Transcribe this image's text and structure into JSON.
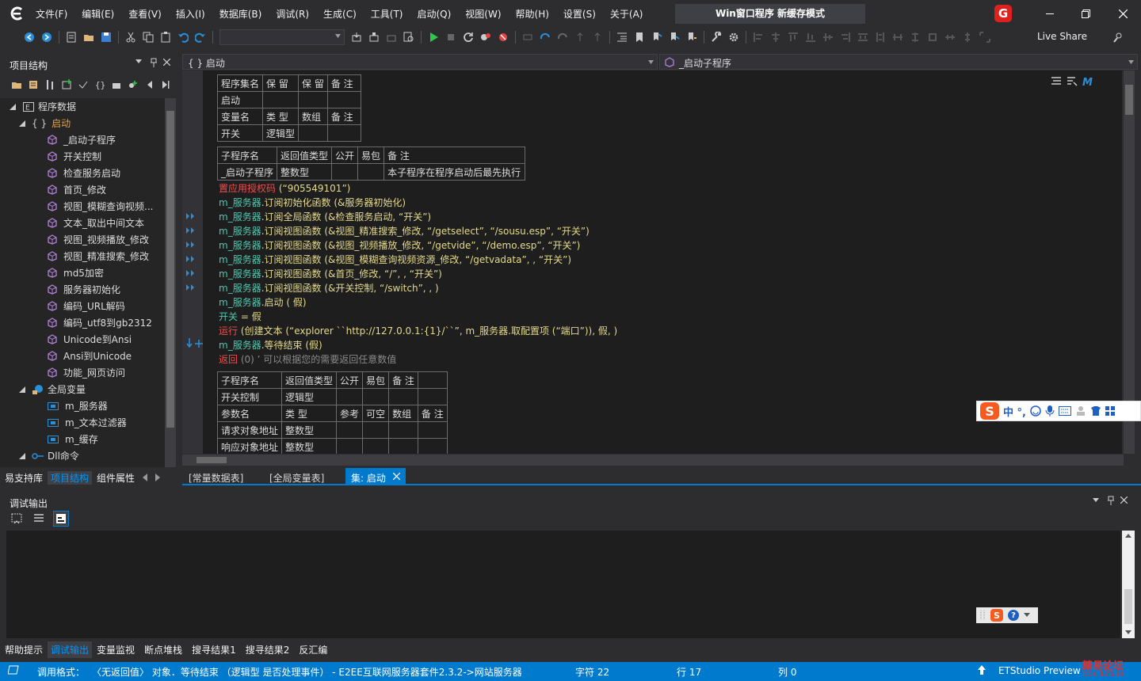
{
  "window": {
    "title": "Win窗口程序  新缓存模式",
    "badge": "G"
  },
  "menu": [
    "文件(F)",
    "编辑(E)",
    "查看(V)",
    "插入(I)",
    "数据库(B)",
    "调试(R)",
    "生成(C)",
    "工具(T)",
    "启动(Q)",
    "视图(W)",
    "帮助(H)",
    "设置(S)",
    "关于(A)"
  ],
  "toolbar": {
    "live_share": "Live Share"
  },
  "left_panel": {
    "title": "项目结构",
    "tabs": [
      "易支持库",
      "项目结构",
      "组件属性"
    ],
    "active_tab": 1
  },
  "tree": {
    "root": "程序数据",
    "set": "启动",
    "subs": [
      "_启动子程序",
      "开关控制",
      "检查服务启动",
      "首页_修改",
      "视图_模糊查询视频...",
      "文本_取出中间文本",
      "视图_视频播放_修改",
      "视图_精准搜索_修改",
      "md5加密",
      "服务器初始化",
      "编码_URL解码",
      "编码_utf8到gb2312",
      "Unicode到Ansi",
      "Ansi到Unicode",
      "功能_网页访问"
    ],
    "globals_label": "全局变量",
    "globals": [
      "m_服务器",
      "m_文本过滤器",
      "m_缓存"
    ],
    "dll": "Dll命令"
  },
  "editor": {
    "nav_left": "{ } 启动",
    "nav_right": "_启动子程序",
    "doc_tabs": [
      {
        "label": "[常量数据表]"
      },
      {
        "label": "[全局变量表]"
      },
      {
        "label": "集: 启动",
        "active": true
      }
    ],
    "table1": {
      "headers": [
        "程序集名",
        "保 留",
        "保 留",
        "备 注"
      ],
      "row": [
        "启动",
        "",
        "",
        ""
      ],
      "headers2": [
        "变量名",
        "类 型",
        "数组",
        "备 注"
      ],
      "row2": [
        "开关",
        "逻辑型",
        "",
        ""
      ]
    },
    "table2": {
      "headers": [
        "子程序名",
        "返回值类型",
        "公开",
        "易包",
        "备 注"
      ],
      "row": [
        "_启动子程序",
        "整数型",
        "",
        "",
        "本子程序在程序启动后最先执行"
      ]
    },
    "lines": [
      {
        "k": "置应用授权码",
        "r": " (“905549101”)"
      },
      {
        "k": "m_服务器",
        "r": ".订阅初始化函数 (&服务器初始化)"
      },
      {
        "k": "m_服务器",
        "r": ".订阅全局函数 (&检查服务启动, “开关”)"
      },
      {
        "k": "m_服务器",
        "r": ".订阅视图函数 (&视图_精准搜索_修改, “/getselect”, “/sousu.esp”, “开关”)"
      },
      {
        "k": "m_服务器",
        "r": ".订阅视图函数 (&视图_视频播放_修改, “/getvide”, “/demo.esp”, “开关”)"
      },
      {
        "k": "m_服务器",
        "r": ".订阅视图函数 (&视图_模糊查询视频资源_修改, “/getvadata”, , “开关”)"
      },
      {
        "k": "m_服务器",
        "r": ".订阅视图函数 (&首页_修改, “/”, , “开关”)"
      },
      {
        "k": "m_服务器",
        "r": ".订阅视图函数 (&开关控制, “/switch”, , )"
      },
      {
        "k": "m_服务器",
        "r": ".启动 ( 假)"
      },
      {
        "k": "开关",
        "r": " = 假"
      },
      {
        "k": "运行",
        "r": " (创建文本 (“explorer ``http://127.0.0.1:{1}/``”, m_服务器.取配置项 (“端口”)), 假, )"
      },
      {
        "k": "m_服务器",
        "r": ".等待结束 (假)"
      },
      {
        "k": "返回",
        "r": " (0) ’ 可以根据您的需要返回任意数值"
      }
    ],
    "table3": {
      "headers": [
        "子程序名",
        "返回值类型",
        "公开",
        "易包",
        "备 注"
      ],
      "row": [
        "开关控制",
        "逻辑型",
        "",
        "",
        ""
      ],
      "headers2": [
        "参数名",
        "类 型",
        "参考",
        "可空",
        "数组",
        "备 注"
      ],
      "rows2": [
        [
          "请求对象地址",
          "整数型",
          "",
          "",
          "",
          ""
        ],
        [
          "响应对象地址",
          "整数型",
          "",
          "",
          "",
          ""
        ]
      ]
    }
  },
  "output_panel": {
    "title": "调试输出",
    "tabs": [
      "帮助提示",
      "调试输出",
      "变量监视",
      "断点堆栈",
      "搜寻结果1",
      "搜寻结果2",
      "反汇编"
    ],
    "active_tab": 1
  },
  "ime": {
    "label": "中 °,"
  },
  "status": {
    "call_format": "调用格式：",
    "signature": "〈无返回值〉 对象．等待结束 （逻辑型 是否处理事件） - E2EE互联网服务器套件2.3.2->网站服务器",
    "char": "字符 22",
    "line": "行 17",
    "col": "列 0",
    "product": "ETStudio Preview",
    "watermark": "精易论坛",
    "watermark2": "bbs.125.la"
  },
  "colors": {
    "accent": "#007acc",
    "bg": "#2d2d30",
    "editor": "#1e1e1e"
  }
}
